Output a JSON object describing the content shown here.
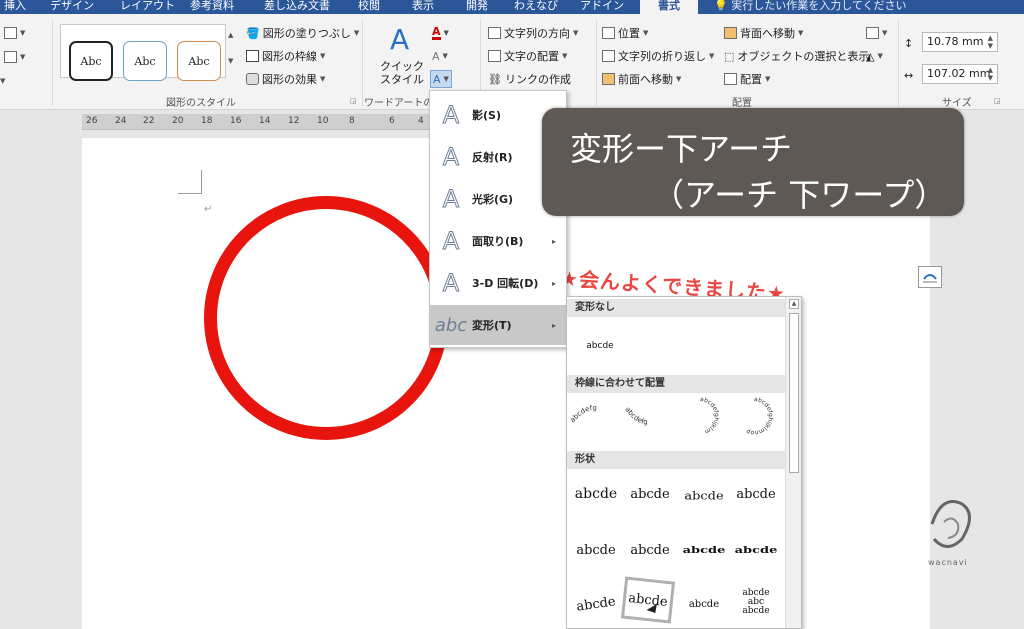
{
  "tabs": [
    "挿入",
    "デザイン",
    "レイアウト",
    "参考資料",
    "差し込み文書",
    "校閲",
    "表示",
    "開発",
    "わえなび",
    "アドイン",
    "書式"
  ],
  "tell_me": "実行したい作業を入力してください",
  "ribbon": {
    "shape_styles": {
      "samples": [
        "Abc",
        "Abc",
        "Abc"
      ],
      "fill": "図形の塗りつぶし",
      "outline": "図形の枠線",
      "effects": "図形の効果",
      "label": "図形のスタイル"
    },
    "wordart": {
      "quick_style": "クイック\nスタイル",
      "label": "ワードアートの"
    },
    "text": {
      "direction": "文字列の方向",
      "align": "文字の配置",
      "link": "リンクの作成"
    },
    "arrange": {
      "position": "位置",
      "wrap": "文字列の折り返し",
      "forward": "前面へ移動",
      "backward": "背面へ移動",
      "selection_pane": "オブジェクトの選択と表示",
      "align": "配置",
      "label": "配置"
    },
    "size": {
      "height": "10.78 mm",
      "width": "107.02 mm",
      "label": "サイズ"
    }
  },
  "ruler_ticks": [
    "26",
    "24",
    "22",
    "20",
    "18",
    "16",
    "14",
    "12",
    "10",
    "8",
    "6",
    "4"
  ],
  "document": {
    "banner_text": "★会んよくできました★"
  },
  "text_effects_menu": [
    {
      "label": "影(S)",
      "glyph": "A"
    },
    {
      "label": "反射(R)",
      "glyph": "A"
    },
    {
      "label": "光彩(G)",
      "glyph": "A"
    },
    {
      "label": "面取り(B)",
      "glyph": "A"
    },
    {
      "label": "3-D 回転(D)",
      "glyph": "A"
    },
    {
      "label": "変形(T)",
      "glyph": "abc"
    }
  ],
  "transform_gallery": {
    "sections": [
      "変形なし",
      "枠線に合わせて配置",
      "形状"
    ],
    "no_transform_sample": "abcde",
    "path_samples": [
      "abcdefg",
      "abcdefg",
      "abcdefghijklm",
      "abcdefghijklmnop"
    ],
    "shape_samples": [
      "abcde",
      "abcde",
      "abcde",
      "abcde",
      "abcde",
      "abcde",
      "abcde",
      "abcde",
      "abcde",
      "abcde",
      "abcde",
      "abcde\nabc\nabcde"
    ]
  },
  "callout": {
    "line1": "変形ー下アーチ",
    "line2": "（アーチ 下ワープ）"
  },
  "watermark": "wacnavi",
  "colors": {
    "tab_bar": "#2b579a",
    "circle": "#e8140e",
    "callout_bg": "#5f5955",
    "highlight": "#c8c8c8"
  }
}
